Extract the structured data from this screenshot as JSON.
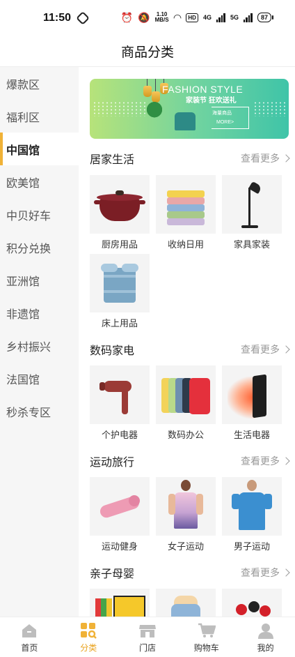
{
  "status_bar": {
    "time": "11:50",
    "net_speed_top": "1.10",
    "net_speed_bottom": "MB/S",
    "hd": "HD",
    "sig1": "4G",
    "sig2": "5G",
    "battery": "87"
  },
  "header": {
    "title": "商品分类"
  },
  "sidebar": {
    "items": [
      {
        "label": "爆款区"
      },
      {
        "label": "福利区"
      },
      {
        "label": "中国馆"
      },
      {
        "label": "欧美馆"
      },
      {
        "label": "中贝好车"
      },
      {
        "label": "积分兑换"
      },
      {
        "label": "亚洲馆"
      },
      {
        "label": "非遗馆"
      },
      {
        "label": "乡村振兴"
      },
      {
        "label": "法国馆"
      },
      {
        "label": "秒杀专区"
      }
    ],
    "active_index": 2
  },
  "banner": {
    "title": "FASHION STYLE",
    "subtitle": "家装节 狂欢送礼",
    "tag": "海量商品",
    "more": "MORE>"
  },
  "more_label": "查看更多",
  "sections": [
    {
      "title": "居家生活",
      "items": [
        {
          "label": "厨房用品",
          "icon": "casserole-pot-icon"
        },
        {
          "label": "收纳日用",
          "icon": "folded-towels-icon"
        },
        {
          "label": "家具家装",
          "icon": "floor-lamp-icon"
        },
        {
          "label": "床上用品",
          "icon": "bedding-set-icon"
        }
      ]
    },
    {
      "title": "数码家电",
      "items": [
        {
          "label": "个护电器",
          "icon": "hair-dryer-icon"
        },
        {
          "label": "数码办公",
          "icon": "phone-cases-icon"
        },
        {
          "label": "生活电器",
          "icon": "space-heater-icon"
        }
      ]
    },
    {
      "title": "运动旅行",
      "items": [
        {
          "label": "运动健身",
          "icon": "yoga-mat-icon"
        },
        {
          "label": "女子运动",
          "icon": "womens-sportswear-icon"
        },
        {
          "label": "男子运动",
          "icon": "mens-sportswear-icon"
        }
      ]
    },
    {
      "title": "亲子母婴",
      "items": [
        {
          "label": "",
          "icon": "kids-books-icon"
        },
        {
          "label": "",
          "icon": "baby-bottle-icon"
        },
        {
          "label": "",
          "icon": "toy-icon"
        }
      ]
    }
  ],
  "bottom_nav": {
    "items": [
      {
        "label": "首页",
        "icon": "home-icon"
      },
      {
        "label": "分类",
        "icon": "category-icon"
      },
      {
        "label": "门店",
        "icon": "store-icon"
      },
      {
        "label": "购物车",
        "icon": "cart-icon"
      },
      {
        "label": "我的",
        "icon": "profile-icon"
      }
    ],
    "active_index": 1
  },
  "colors": {
    "accent": "#f0b237",
    "nav_active": "#e9a21c",
    "sidebar_bg": "#f6f6f6"
  }
}
